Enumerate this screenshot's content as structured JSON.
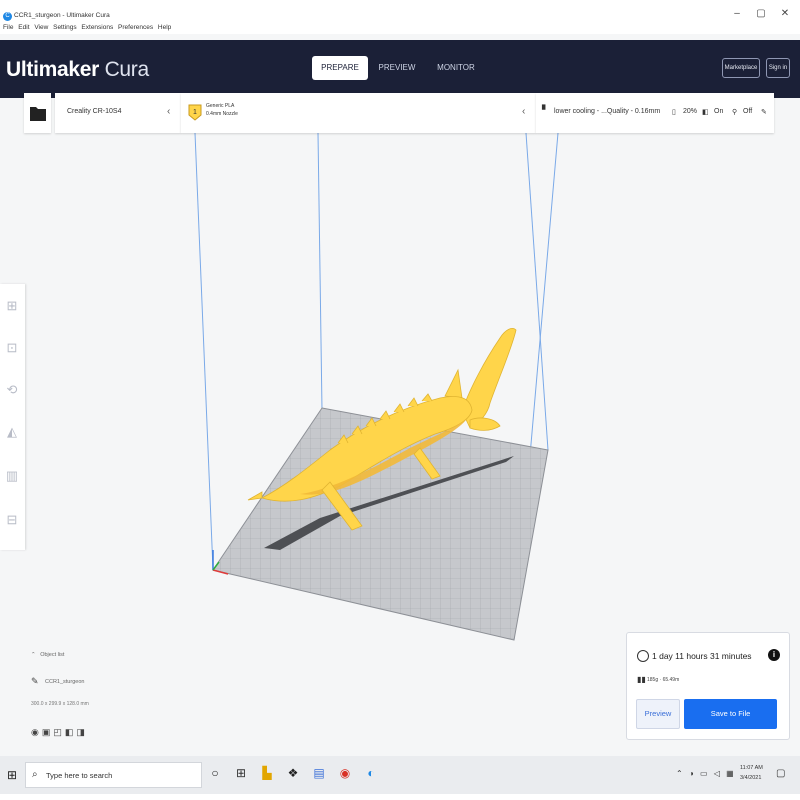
{
  "window": {
    "title": "CCR1_sturgeon - Ultimaker Cura",
    "app_icon": "C",
    "menu": [
      "File",
      "Edit",
      "View",
      "Settings",
      "Extensions",
      "Preferences",
      "Help"
    ],
    "controls": {
      "minimize": "–",
      "maximize": "▢",
      "close": "✕"
    }
  },
  "header": {
    "logo_bold": "Ultimaker",
    "logo_light": "Cura",
    "tabs": [
      "PREPARE",
      "PREVIEW",
      "MONITOR"
    ],
    "active_tab": "PREPARE",
    "marketplace": "Marketplace",
    "sign_in": "Sign in"
  },
  "toolbar": {
    "printer": "Creality CR-10S4",
    "material_name": "Generic PLA",
    "nozzle": "0.4mm Nozzle",
    "profile": "lower cooling - ...Quality - 0.16mm",
    "infill": "20%",
    "support": "On",
    "adhesion": "Off"
  },
  "object_list": {
    "toggle_label": "Object list",
    "object_name": "CCR1_sturgeon",
    "dimensions": "300.0 x 299.9 x 128.0 mm"
  },
  "print_panel": {
    "time": "1 day 11 hours 31 minutes",
    "material_usage": "185g · 65.49m",
    "info_icon": "i",
    "preview_label": "Preview",
    "save_label": "Save to File"
  },
  "taskbar": {
    "search_placeholder": "Type here to search",
    "time": "11:07 AM",
    "date": "3/4/2021"
  },
  "colors": {
    "header_bg": "#1b2037",
    "accent_blue": "#196ef0",
    "model_yellow": "#ffd54a",
    "build_plate": "#c6c8cc"
  },
  "icons": {
    "tools": [
      "move-icon",
      "scale-icon",
      "rotate-icon",
      "mirror-icon",
      "per-model-settings-icon",
      "support-blocker-icon"
    ],
    "taskbar": [
      "windows-start-icon",
      "task-view-icon",
      "dell-icon",
      "file-explorer-icon",
      "dropbox-icon",
      "store-icon",
      "chrome-icon",
      "cura-icon"
    ]
  }
}
